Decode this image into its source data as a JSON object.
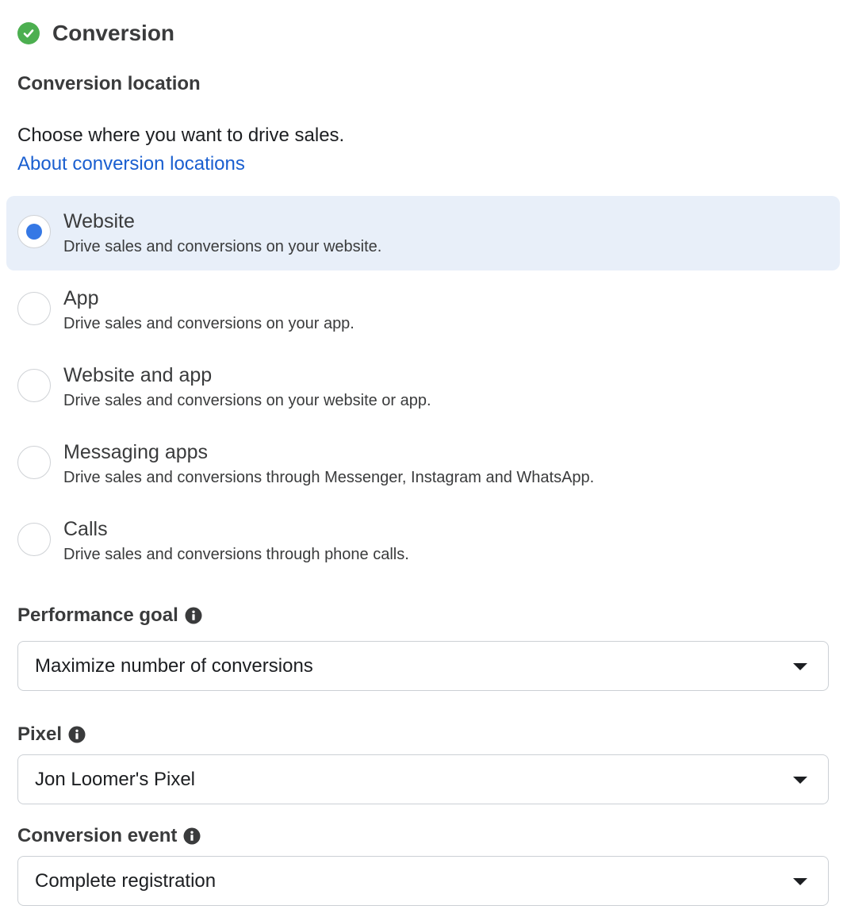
{
  "header": {
    "title": "Conversion",
    "status_icon": "check-circle-icon",
    "status_color": "#4caf50"
  },
  "conversion_location": {
    "label": "Conversion location",
    "description": "Choose where you want to drive sales.",
    "link": "About conversion locations",
    "selected": "Website",
    "options": [
      {
        "title": "Website",
        "subtitle": "Drive sales and conversions on your website."
      },
      {
        "title": "App",
        "subtitle": "Drive sales and conversions on your app."
      },
      {
        "title": "Website and app",
        "subtitle": "Drive sales and conversions on your website or app."
      },
      {
        "title": "Messaging apps",
        "subtitle": "Drive sales and conversions through Messenger, Instagram and WhatsApp."
      },
      {
        "title": "Calls",
        "subtitle": "Drive sales and conversions through phone calls."
      }
    ]
  },
  "performance_goal": {
    "label": "Performance goal",
    "value": "Maximize number of conversions"
  },
  "pixel": {
    "label": "Pixel",
    "value": "Jon Loomer's Pixel"
  },
  "conversion_event": {
    "label": "Conversion event",
    "value": "Complete registration"
  },
  "colors": {
    "accent": "#3578e5",
    "link": "#1a5fd0",
    "selected_bg": "#e8eff9"
  }
}
